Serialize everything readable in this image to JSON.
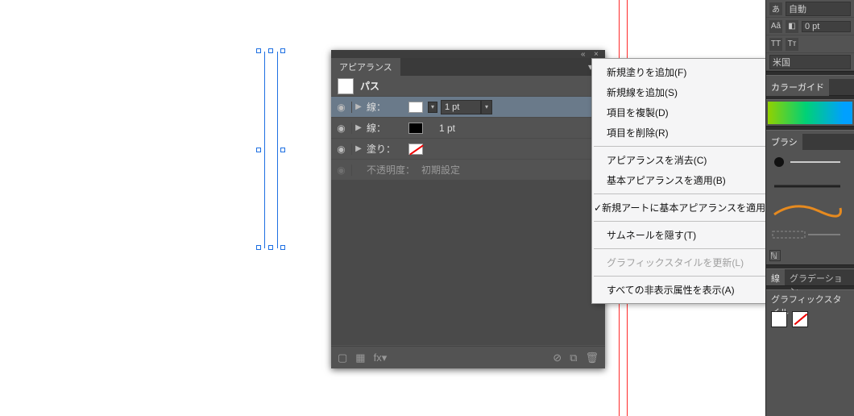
{
  "appearance_panel": {
    "title": "アピアランス",
    "object_label": "パス",
    "rows": [
      {
        "kind": "stroke",
        "label": "線：",
        "swatch": "white",
        "weight": "1 pt",
        "selected": true
      },
      {
        "kind": "stroke",
        "label": "線：",
        "swatch": "black",
        "weight": "1 pt",
        "selected": false
      },
      {
        "kind": "fill",
        "label": "塗り：",
        "swatch": "none",
        "selected": false
      },
      {
        "kind": "opacity",
        "label": "不透明度：",
        "value": "初期設定",
        "dim": true
      }
    ],
    "footer_icons": [
      "box",
      "grid",
      "fx",
      "no",
      "dup",
      "trash"
    ]
  },
  "context_menu": {
    "items": [
      {
        "label": "新規塗りを追加(F)"
      },
      {
        "label": "新規線を追加(S)"
      },
      {
        "label": "項目を複製(D)"
      },
      {
        "label": "項目を削除(R)"
      },
      {
        "sep": true
      },
      {
        "label": "アピアランスを消去(C)"
      },
      {
        "label": "基本アピアランスを適用(B)"
      },
      {
        "sep": true
      },
      {
        "label": "新規アートに基本アピアランスを適用(N)",
        "checked": true
      },
      {
        "sep": true
      },
      {
        "label": "サムネールを隠す(T)"
      },
      {
        "sep": true
      },
      {
        "label": "グラフィックスタイルを更新(L)",
        "disabled": true
      },
      {
        "sep": true
      },
      {
        "label": "すべての非表示属性を表示(A)"
      }
    ]
  },
  "dock": {
    "auto_label": "自動",
    "pt_value": "0 pt",
    "country": "米国",
    "color_guide": "カラーガイド",
    "brush_tab": "ブラシ",
    "stroke_tab": "線",
    "grad_tab": "グラデーション",
    "gstyle_tab": "グラフィックスタイル"
  }
}
